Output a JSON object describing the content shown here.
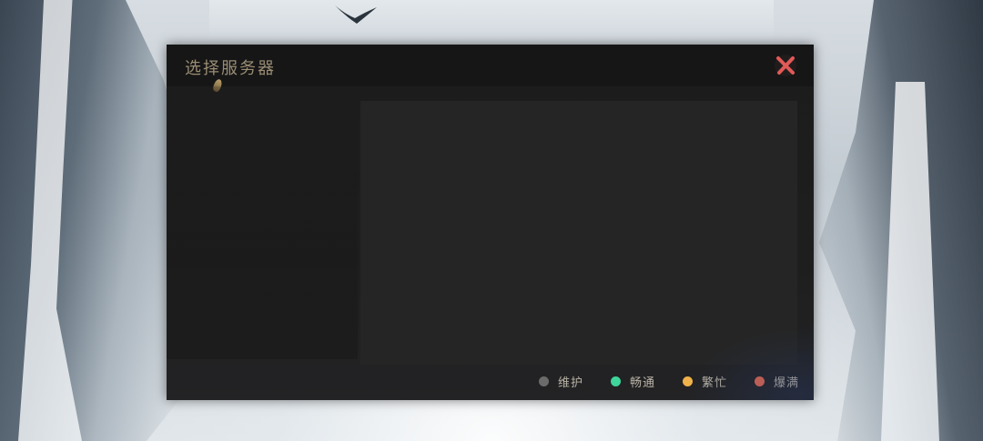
{
  "dialog": {
    "title": "选择服务器",
    "close_icon": "close-x-icon"
  },
  "legend": {
    "items": [
      {
        "label": "维护",
        "color": "#6b6b6b"
      },
      {
        "label": "畅通",
        "color": "#3fd49a"
      },
      {
        "label": "繁忙",
        "color": "#f0b24a"
      },
      {
        "label": "爆满",
        "color": "#e2674f"
      }
    ]
  },
  "colors": {
    "title": "#9a8d74",
    "close_icon": "#e05a58",
    "panel": "#252525"
  }
}
